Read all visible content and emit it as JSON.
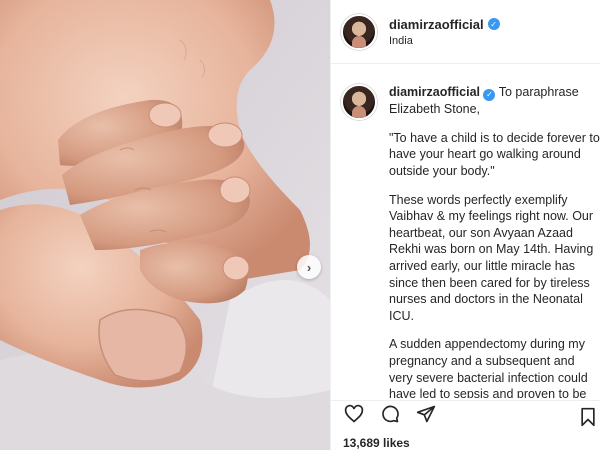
{
  "post": {
    "username": "diamirzaofficial",
    "verified": true,
    "location": "India",
    "caption_paragraphs": [
      "\"To have a child is to decide forever to have your heart go walking around outside your body.\"",
      "These words perfectly exemplify Vaibhav & my feelings right now. Our heartbeat, our son Avyaan Azaad Rekhi was born on May 14th. Having arrived early, our little miracle has since then been cared for by tireless nurses and doctors in the Neonatal ICU.",
      "A sudden appendectomy during my pregnancy and a subsequent and very severe bacterial infection could have led to sepsis and proven to be life"
    ],
    "caption_lead": "To paraphrase Elizabeth Stone,",
    "likes_text": "13,689 likes"
  },
  "icons": {
    "verified": "verified-badge-icon",
    "carousel": "chevron-right-icon",
    "like": "heart-icon",
    "comment": "comment-icon",
    "share": "paper-plane-icon",
    "save": "bookmark-icon"
  },
  "colors": {
    "verified_blue": "#3897f0",
    "text": "#262626",
    "divider": "#efefef"
  }
}
